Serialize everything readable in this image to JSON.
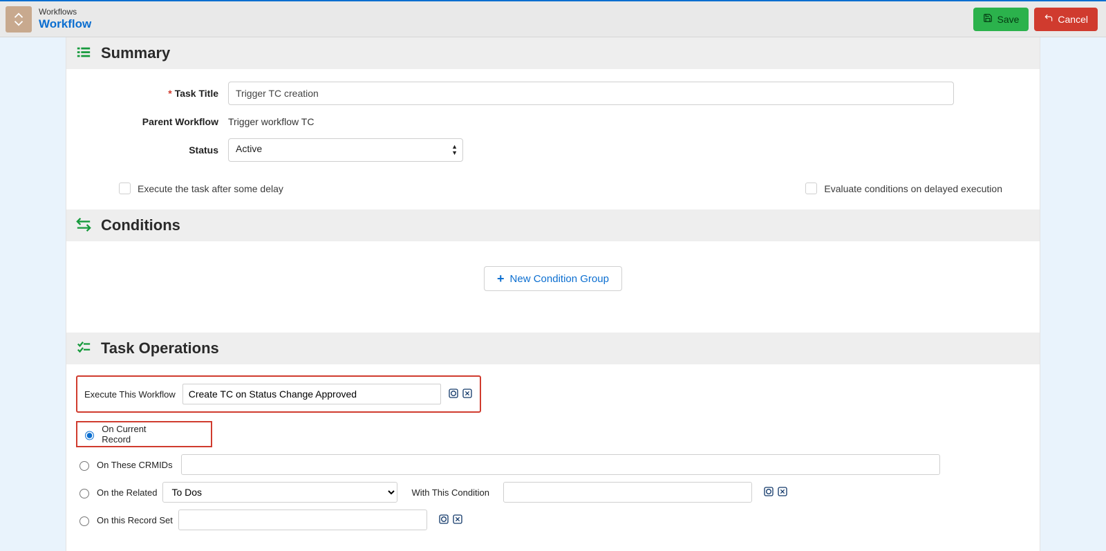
{
  "header": {
    "breadcrumb": "Workflows",
    "title": "Workflow",
    "buttons": {
      "save": "Save",
      "cancel": "Cancel"
    }
  },
  "sections": {
    "summary": "Summary",
    "conditions": "Conditions",
    "task_ops": "Task Operations"
  },
  "summary": {
    "labels": {
      "task_title": "Task Title",
      "parent_workflow": "Parent Workflow",
      "status": "Status",
      "execute_delay": "Execute the task after some delay",
      "eval_delayed": "Evaluate conditions on delayed execution"
    },
    "values": {
      "task_title": "Trigger TC creation",
      "parent_workflow": "Trigger workflow TC",
      "status": "Active"
    }
  },
  "conditions": {
    "new_group": "New Condition Group"
  },
  "task_ops": {
    "execute_label": "Execute This Workflow",
    "execute_value": "Create TC on Status Change Approved",
    "radios": {
      "current": "On Current Record",
      "crmids": "On These CRMIDs",
      "related": "On the Related",
      "recordset": "On this Record Set"
    },
    "related_value": "To Dos",
    "with_condition_label": "With This Condition"
  }
}
